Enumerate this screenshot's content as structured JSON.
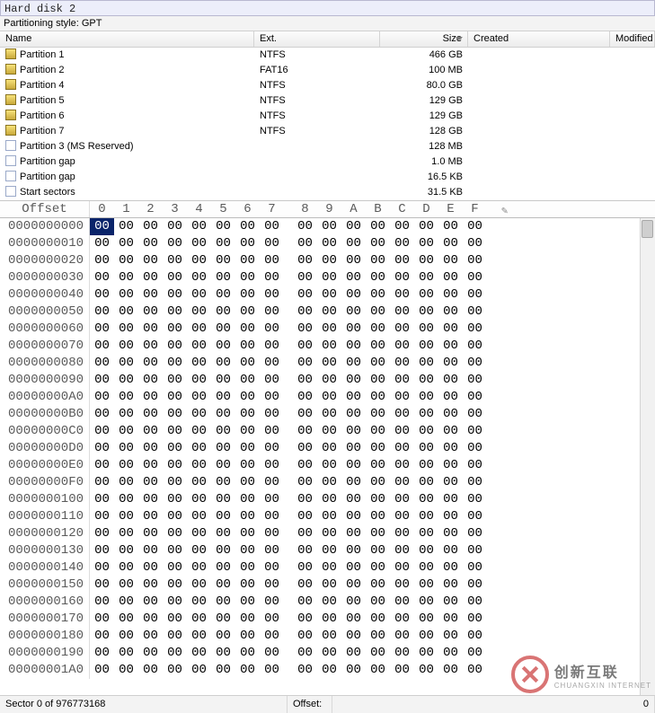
{
  "title": "Hard disk 2",
  "partition_style_label": "Partitioning style: GPT",
  "columns": {
    "name": "Name",
    "ext": "Ext.",
    "size": "Size",
    "created": "Created",
    "modified": "Modified"
  },
  "partitions": [
    {
      "icon": "part",
      "name": "Partition 1",
      "ext": "NTFS",
      "size": "466 GB"
    },
    {
      "icon": "part",
      "name": "Partition 2",
      "ext": "FAT16",
      "size": "100 MB"
    },
    {
      "icon": "part",
      "name": "Partition 4",
      "ext": "NTFS",
      "size": "80.0 GB"
    },
    {
      "icon": "part",
      "name": "Partition 5",
      "ext": "NTFS",
      "size": "129 GB"
    },
    {
      "icon": "part",
      "name": "Partition 6",
      "ext": "NTFS",
      "size": "129 GB"
    },
    {
      "icon": "part",
      "name": "Partition 7",
      "ext": "NTFS",
      "size": "128 GB"
    },
    {
      "icon": "plain",
      "name": "Partition 3 (MS Reserved)",
      "ext": "",
      "size": "128 MB"
    },
    {
      "icon": "plain",
      "name": "Partition gap",
      "ext": "",
      "size": "1.0 MB"
    },
    {
      "icon": "plain",
      "name": "Partition gap",
      "ext": "",
      "size": "16.5 KB"
    },
    {
      "icon": "plain",
      "name": "Start sectors",
      "ext": "",
      "size": "31.5 KB"
    }
  ],
  "hex": {
    "header_label": "Offset",
    "col_labels": [
      "0",
      "1",
      "2",
      "3",
      "4",
      "5",
      "6",
      "7",
      "8",
      "9",
      "A",
      "B",
      "C",
      "D",
      "E",
      "F"
    ],
    "row_start_hex": "0000000000",
    "rows": 27,
    "byte_value": "00",
    "selected": {
      "row": 0,
      "col": 0,
      "display": "0"
    }
  },
  "status": {
    "sector": "Sector 0 of 976773168",
    "offset_label": "Offset:",
    "offset_value": "0"
  },
  "watermark": {
    "brand": "创新互联",
    "sub": "CHUANGXIN INTERNET"
  }
}
